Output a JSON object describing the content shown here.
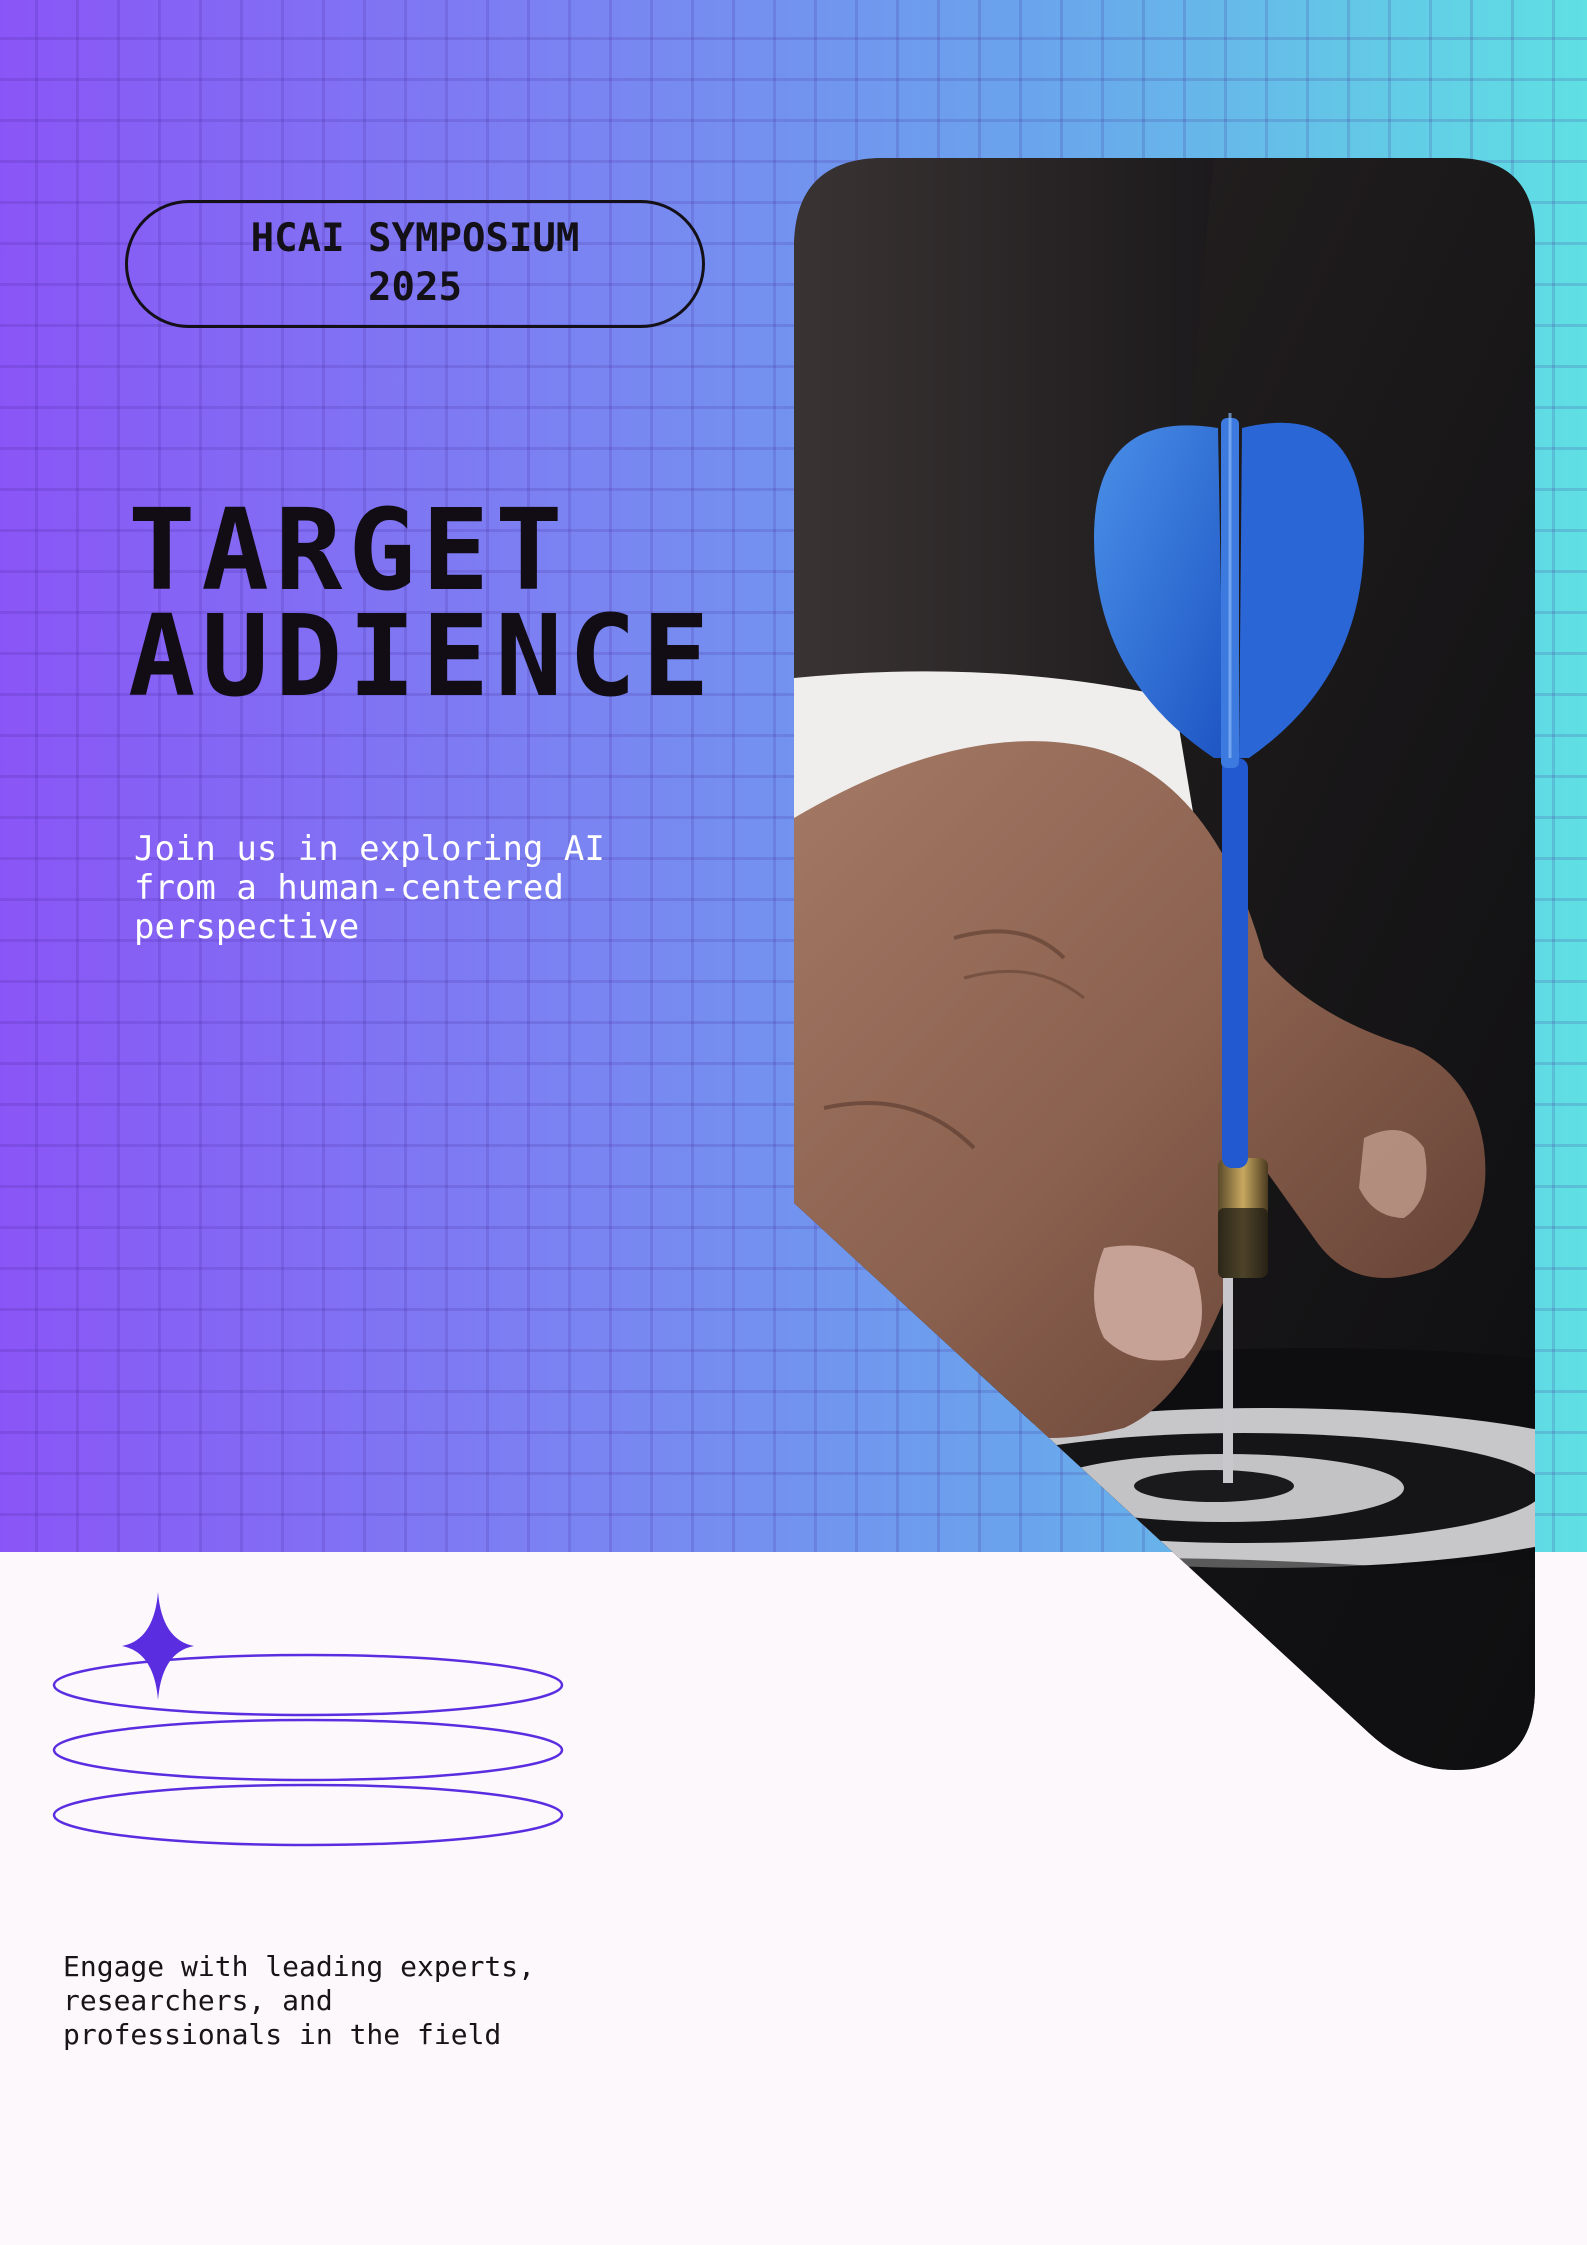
{
  "badge": {
    "line1": "HCAI SYMPOSIUM",
    "line2": "2025"
  },
  "title": {
    "line1": "TARGET",
    "line2": "AUDIENCE"
  },
  "intro": {
    "line1": "Join us in exploring AI",
    "line2": "from a human-centered",
    "line3": "perspective"
  },
  "photo": {
    "subject": "hand placing a blue dart on a dartboard bullseye"
  },
  "decoration": {
    "icon": "sparkle-icon",
    "accent": "#5a2ee0"
  },
  "outro": {
    "line1": "Engage with leading experts,",
    "line2": "researchers, and",
    "line3": "professionals in the field"
  },
  "colors": {
    "gradient_start": "#8a55f6",
    "gradient_end": "#5fe0e3",
    "page_background": "#fdf8fc",
    "heading": "#120c14"
  }
}
